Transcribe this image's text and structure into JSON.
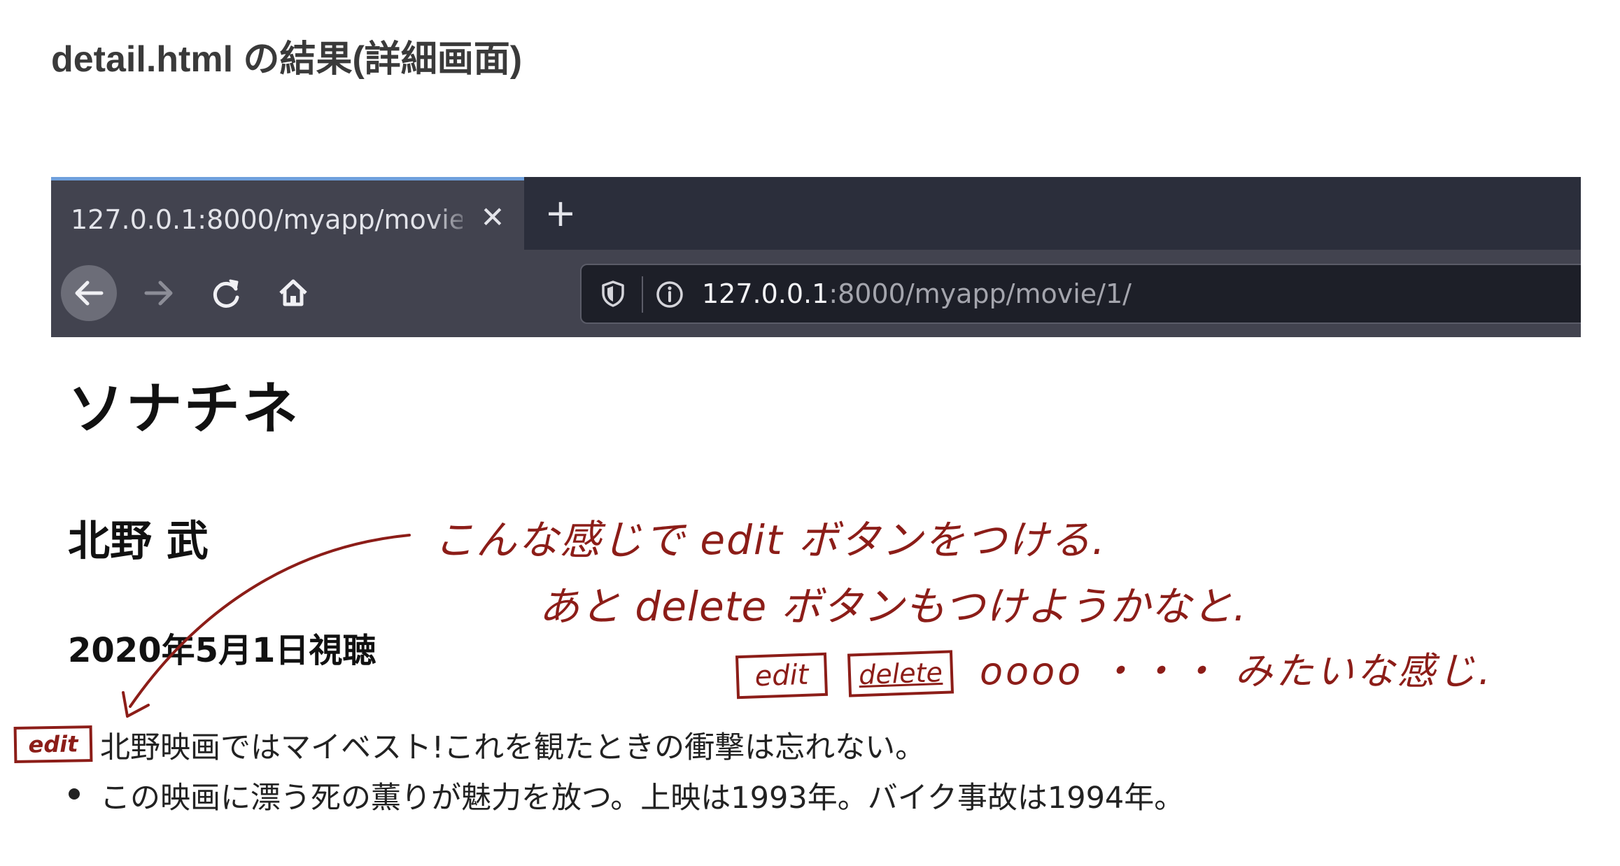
{
  "heading": "detail.html の結果(詳細画面)",
  "browser": {
    "tab_title": "127.0.0.1:8000/myapp/movie/1/",
    "tab_close_icon": "close-icon",
    "new_tab_icon": "plus-icon",
    "nav_icons": [
      "back-arrow-icon",
      "forward-arrow-icon",
      "reload-icon",
      "home-icon"
    ],
    "url_host": "127.0.0.1",
    "url_rest": ":8000/myapp/movie/1/",
    "tab_accent_color": "#6fa0dc"
  },
  "page": {
    "title": "ソナチネ",
    "director": "北野 武",
    "watched_date": "2020年5月1日視聴",
    "reviews": [
      "北野映画ではマイベスト!これを観たときの衝撃は忘れない。",
      "この映画に漂う死の薫りが魅力を放つ。上映は1993年。バイク事故は1994年。"
    ]
  },
  "annotations": {
    "color": "#8c1d18",
    "note_1": "こんな感じで edit ボタンをつける.",
    "note_2": "あと delete ボタンもつけようかなと.",
    "note_3": "oooo ・・・ みたいな感じ.",
    "sketch_edit": "edit",
    "sketch_delete": "delete",
    "sketch_edit_small": "edit"
  }
}
